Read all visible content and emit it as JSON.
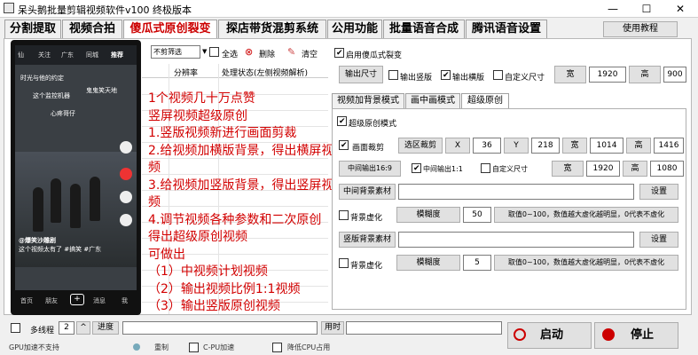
{
  "window": {
    "title": "呆头鹅批量剪辑视频软件v100 终极版本",
    "minimize": "—",
    "maximize": "☐",
    "close": "✕"
  },
  "tabs": [
    "分割提取",
    "视频合拍",
    "傻瓜式原创裂变",
    "探店带货混剪系统",
    "公用功能",
    "批量语音合成",
    "腾讯语音设置"
  ],
  "help_button": "使用教程",
  "toolbar": {
    "filter_value": "不剪筛选",
    "select_all": "全选",
    "delete": "删除",
    "clear": "清空"
  },
  "grid": {
    "headers": [
      "分辨率",
      "处理状态(左侧视频解析)"
    ]
  },
  "phone": {
    "nav": [
      "仙",
      "关注",
      "广东",
      "同城",
      "推荐"
    ],
    "comments": [
      "时光与他的约定",
      "这个监控机器",
      "鬼鬼笑天地",
      "心疼哥仔"
    ],
    "handle": "@爆笑沙雕剧",
    "caption": "这个视频太有了 #搞笑 #广东",
    "bottom": [
      "首页",
      "朋友",
      "消息",
      "我"
    ]
  },
  "promo_lines": [
    "1个视频几十万点赞",
    "竖屏视频超级原创",
    "1.竖版视频新进行画面剪裁",
    "2.给视频加横版背景，得出横屏视频",
    "3.给视频加竖版背景，得出竖屏视频",
    "4.调节视频各种参数和二次原创",
    "得出超级原创视频",
    "可做出",
    "（1）中视频计划视频",
    "（2）输出视频比例1:1视频",
    "（3）输出竖版原创视频"
  ],
  "right_top": {
    "enable_label": "启用傻瓜式裂变",
    "output_size": "输出尺寸",
    "out_vertical": "输出竖版",
    "out_horizontal": "输出横版",
    "custom_size": "自定义尺寸",
    "width_label": "宽",
    "width_value": "1920",
    "height_label": "高",
    "height_value": "900"
  },
  "subtabs": [
    "视频加背景模式",
    "画中画模式",
    "超级原创"
  ],
  "super": {
    "enable": "超级原创模式",
    "crop": "画面裁剪",
    "select_crop": "选区裁剪",
    "x_label": "X",
    "x_value": "36",
    "y_label": "Y",
    "y_value": "218",
    "w_label": "宽",
    "w_value": "1014",
    "h_label": "高",
    "h_value": "1416",
    "mid169": "中间输出16:9",
    "mid11": "中间输出1:1",
    "custom": "自定义尺寸",
    "cw_label": "宽",
    "cw_value": "1920",
    "ch_label": "高",
    "ch_value": "1080",
    "mid_bg": "中间背景素材",
    "set1": "设置",
    "blur1": "背景虚化",
    "blur_deg1": "模糊度",
    "blur_val1": "50",
    "blur_hint1": "取值0~100，数值越大虚化越明显，0代表不虚化",
    "vert_bg": "竖版背景素材",
    "set2": "设置",
    "blur2": "背景虚化",
    "blur_deg2": "模糊度",
    "blur_val2": "5",
    "blur_hint2": "取值0~100，数值越大虚化越明显，0代表不虚化"
  },
  "bottom": {
    "multithread": "多线程",
    "threads": "2",
    "progress": "进度",
    "elapsed": "用时",
    "start": "启动",
    "stop": "停止",
    "gpu": "GPU加速不支持",
    "dedup": "重制",
    "cpu_acc": "C-PU加速",
    "low_cpu": "降低CPU占用"
  }
}
